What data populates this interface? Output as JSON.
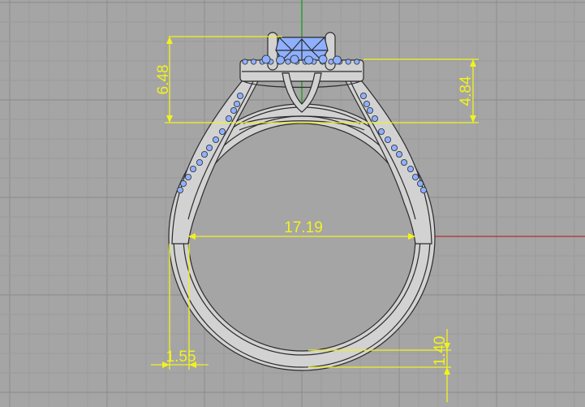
{
  "viewport": {
    "background": "#a5a5a5",
    "grid_minor_color": "#9c9c9c",
    "grid_major_color": "#8f8f8f",
    "axis_x_color": "#b03030",
    "axis_y_color": "#1f9e1f"
  },
  "model": {
    "object": "ring",
    "metal_color": "#d2d2d2",
    "gem_color": "#8fb0ff",
    "edge_color": "#2b2b2b"
  },
  "dimension_style": {
    "color": "#f2f21e"
  },
  "dimensions": {
    "head_height": "6.48",
    "halo_height": "4.84",
    "inner_diameter": "17.19",
    "band_width": "1.55",
    "band_thickness": "1.40"
  }
}
